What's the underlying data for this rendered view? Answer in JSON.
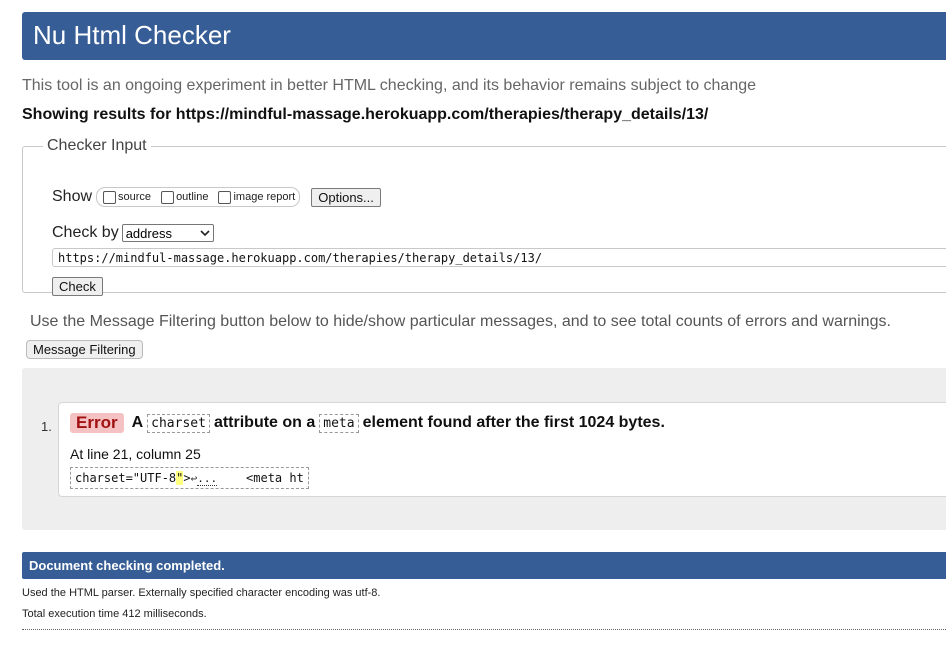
{
  "header": {
    "title": "Nu Html Checker"
  },
  "intro": "This tool is an ongoing experiment in better HTML checking, and its behavior remains subject to change",
  "showing": "Showing results for https://mindful-massage.herokuapp.com/therapies/therapy_details/13/",
  "checker": {
    "legend": "Checker Input",
    "show_label": "Show",
    "options": [
      "source",
      "outline",
      "image report"
    ],
    "options_button": "Options...",
    "check_by_label": "Check by",
    "check_by_value": "address",
    "url_value": "https://mindful-massage.herokuapp.com/therapies/therapy_details/13/",
    "check_button": "Check"
  },
  "filter": {
    "text": "Use the Message Filtering button below to hide/show particular messages, and to see total counts of errors and warnings.",
    "button": "Message Filtering"
  },
  "messages": [
    {
      "number": "1.",
      "type": "Error",
      "text_a": "A",
      "code1": "charset",
      "text_b": "attribute on a",
      "code2": "meta",
      "text_c": "element found after the first 1024 bytes.",
      "location": "At line 21, column 25",
      "extract_before": "charset=\"UTF-8",
      "extract_highlight": "\"",
      "extract_after": ">",
      "extract_arrow": "↩",
      "extract_dots": "...",
      "extract_tail": "    <meta ht"
    }
  ],
  "status": {
    "done": "Document checking completed.",
    "parser": "Used the HTML parser. Externally specified character encoding was utf-8.",
    "time": "Total execution time 412 milliseconds."
  },
  "colors": {
    "header_bg": "#365d95",
    "error_badge": "#f4c2c2",
    "highlight": "#ffff80"
  }
}
